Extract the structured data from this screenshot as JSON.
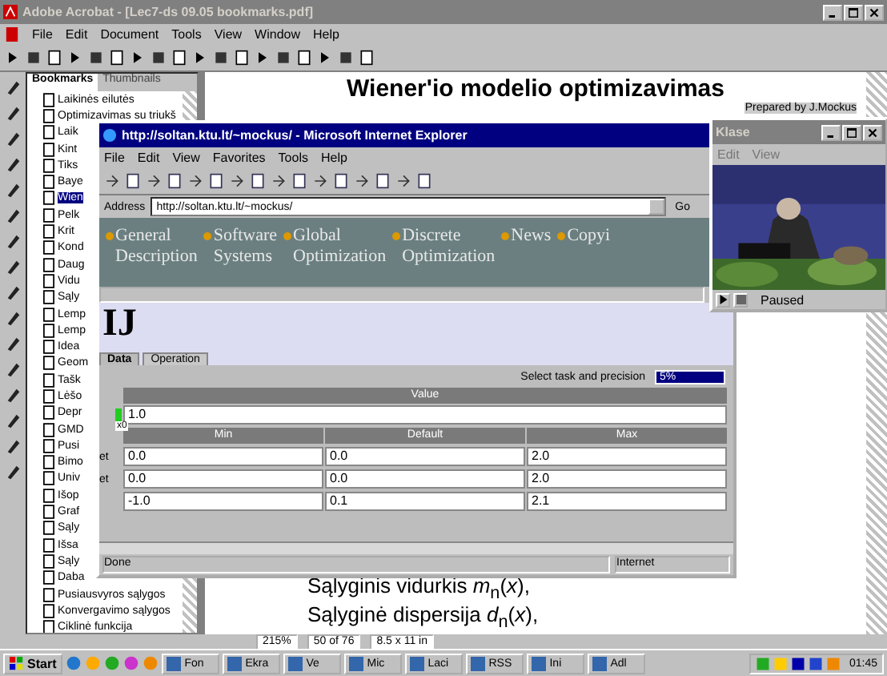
{
  "acrobat": {
    "title": "Adobe Acrobat - [Lec7-ds 09.05 bookmarks.pdf]",
    "menu": [
      "File",
      "Edit",
      "Document",
      "Tools",
      "View",
      "Window",
      "Help"
    ],
    "bookmark_tabs": [
      {
        "label": "Bookmarks",
        "selected": true
      },
      {
        "label": "Thumbnails",
        "selected": false
      }
    ],
    "bookmarks": [
      {
        "label": "Laikinės eilutės",
        "selected": false
      },
      {
        "label": "Optimizavimas su triukš",
        "selected": false
      },
      {
        "label": "Laik",
        "selected": false
      },
      {
        "label": "Kint",
        "selected": false
      },
      {
        "label": "Tiks",
        "selected": false
      },
      {
        "label": "Baye",
        "selected": false
      },
      {
        "label": "Wien",
        "selected": true
      },
      {
        "label": "Pelk",
        "selected": false
      },
      {
        "label": "Krit",
        "selected": false
      },
      {
        "label": "Kond",
        "selected": false
      },
      {
        "label": "Daug",
        "selected": false
      },
      {
        "label": "Vidu",
        "selected": false
      },
      {
        "label": "Sąly",
        "selected": false
      },
      {
        "label": "Lemp",
        "selected": false
      },
      {
        "label": "Lemp",
        "selected": false
      },
      {
        "label": "Idea",
        "selected": false
      },
      {
        "label": "Geom",
        "selected": false
      },
      {
        "label": "Tašk",
        "selected": false
      },
      {
        "label": "Lėšo",
        "selected": false
      },
      {
        "label": "Depr",
        "selected": false
      },
      {
        "label": "GMD",
        "selected": false
      },
      {
        "label": "Pusi",
        "selected": false
      },
      {
        "label": "Bimo",
        "selected": false
      },
      {
        "label": "Univ",
        "selected": false
      },
      {
        "label": "Išop",
        "selected": false
      },
      {
        "label": "Graf",
        "selected": false
      },
      {
        "label": "Sąly",
        "selected": false
      },
      {
        "label": "Išsa",
        "selected": false
      },
      {
        "label": "Sąly",
        "selected": false
      },
      {
        "label": "Daba",
        "selected": false
      },
      {
        "label": "Pusiausvyros sąlygos",
        "selected": false
      },
      {
        "label": "Konvergavimo sąlygos",
        "selected": false
      },
      {
        "label": "Ciklinė funkcija",
        "selected": false
      }
    ],
    "document": {
      "heading": "Wiener'io modelio optimizavimas",
      "note": "Prepared by J.Mockus",
      "lines": [
        "Sąlyginis vidurkis *m*$_{n}$(*x*),",
        "Sąlyginė dispersija *d*$_{n}$(*x*),"
      ]
    },
    "status": {
      "zoom": "215%",
      "page": "50 of 76",
      "size": "8.5 x 11 in"
    }
  },
  "browser": {
    "title": "http://soltan.ktu.lt/~mockus/ - Microsoft Internet Explorer",
    "menu": [
      "File",
      "Edit",
      "View",
      "Favorites",
      "Tools",
      "Help"
    ],
    "address_label": "Address",
    "address": "http://soltan.ktu.lt/~mockus/",
    "go": "Go",
    "nav": [
      {
        "lines": [
          "General",
          "Description"
        ]
      },
      {
        "lines": [
          "Software",
          "Systems"
        ]
      },
      {
        "lines": [
          "Global",
          "Optimization"
        ]
      },
      {
        "lines": [
          "Discrete",
          "Optimization"
        ]
      },
      {
        "lines": [
          "News"
        ]
      },
      {
        "lines": [
          "Copyi"
        ]
      }
    ],
    "applet": {
      "heading": "IJ",
      "tabs": [
        {
          "label": "Data",
          "selected": true
        },
        {
          "label": "Operation",
          "selected": false
        }
      ],
      "precision_label": "Select task and precision",
      "precision_value": "5%",
      "value_header": "Value",
      "value": "1.0",
      "value_label": "x0",
      "range_headers": [
        "Min",
        "Default",
        "Max"
      ],
      "rows": [
        {
          "label": "et",
          "cells": [
            "0.0",
            "0.0",
            "2.0"
          ]
        },
        {
          "label": "et",
          "cells": [
            "0.0",
            "0.0",
            "2.0"
          ]
        },
        {
          "cells": [
            "-1.0",
            "0.1",
            "2.1"
          ]
        }
      ]
    },
    "status": "Done",
    "zone": "Internet"
  },
  "video": {
    "title": "Klase",
    "menu": [
      "Edit",
      "View"
    ],
    "status": "Paused"
  },
  "taskbar": {
    "start": "Start",
    "tasks": [
      "Fon",
      "Ekra",
      "Ve",
      "Mic",
      "Laci",
      "RSS",
      "Ini",
      "Adl"
    ],
    "clock": "01:45"
  }
}
